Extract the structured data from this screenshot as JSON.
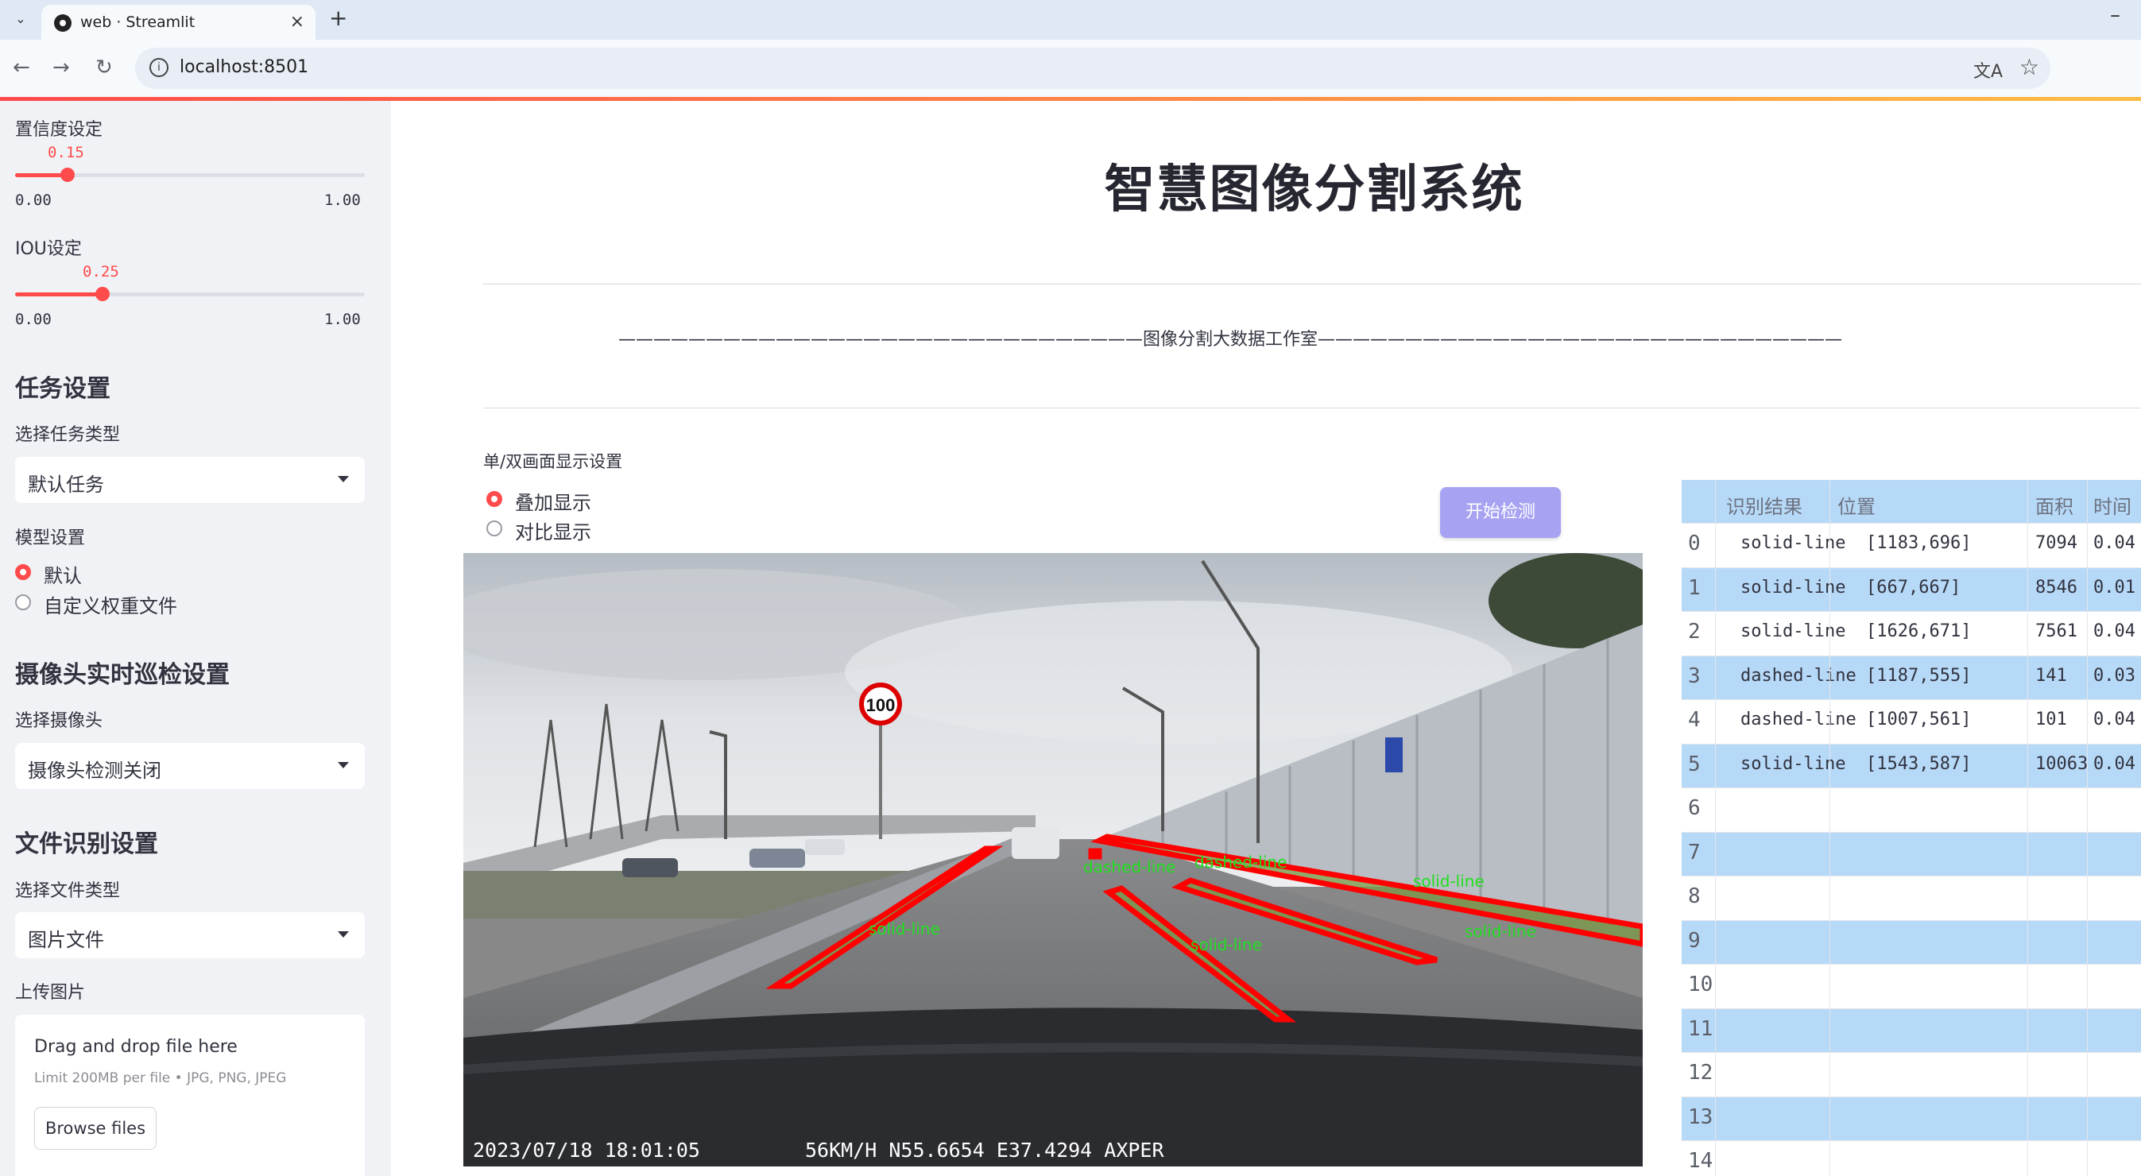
{
  "browser": {
    "tab_title": "web · Streamlit",
    "url": "localhost:8501",
    "close_symbol": "×",
    "new_tab_symbol": "+",
    "minimize_symbol": "–"
  },
  "sidebar": {
    "confidence": {
      "label": "置信度设定",
      "value": "0.15",
      "min": "0.00",
      "max": "1.00",
      "fraction": 0.15
    },
    "iou": {
      "label": "IOU设定",
      "value": "0.25",
      "min": "0.00",
      "max": "1.00",
      "fraction": 0.25
    },
    "task_heading": "任务设置",
    "task_type_label": "选择任务类型",
    "task_type_value": "默认任务",
    "model_label": "模型设置",
    "model_options": [
      "默认",
      "自定义权重文件"
    ],
    "camera_heading": "摄像头实时巡检设置",
    "camera_label": "选择摄像头",
    "camera_value": "摄像头检测关闭",
    "file_heading": "文件识别设置",
    "file_type_label": "选择文件类型",
    "file_type_value": "图片文件",
    "upload_label": "上传图片",
    "upload_title": "Drag and drop file here",
    "upload_sub": "Limit 200MB per file • JPG, PNG, JPEG",
    "upload_button": "Browse files"
  },
  "main": {
    "title": "智慧图像分割系统",
    "studio_line": "——————————————————————————————图像分割大数据工作室——————————————————————————————",
    "display_label": "单/双画面显示设置",
    "display_options": [
      "叠加显示",
      "对比显示"
    ],
    "start_button": "开始检测"
  },
  "image": {
    "timestamp": "2023/07/18 18:01:05",
    "telemetry": "56KM/H N55.6654 E37.4294 AXPER",
    "speed_sign": "100",
    "detections": [
      "solid-line",
      "solid-line",
      "solid-line",
      "solid-line",
      "dashed-line",
      "dashed-line"
    ]
  },
  "table": {
    "headers": [
      "识别结果",
      "位置",
      "面积",
      "时间"
    ],
    "rows": [
      {
        "idx": "0",
        "result": "solid-line",
        "pos": "[1183,696]",
        "area": "7094",
        "time": "0.04"
      },
      {
        "idx": "1",
        "result": "solid-line",
        "pos": "[667,667]",
        "area": "8546",
        "time": "0.01"
      },
      {
        "idx": "2",
        "result": "solid-line",
        "pos": "[1626,671]",
        "area": "7561",
        "time": "0.04"
      },
      {
        "idx": "3",
        "result": "dashed-line",
        "pos": "[1187,555]",
        "area": "141",
        "time": "0.03"
      },
      {
        "idx": "4",
        "result": "dashed-line",
        "pos": "[1007,561]",
        "area": "101",
        "time": "0.04"
      },
      {
        "idx": "5",
        "result": "solid-line",
        "pos": "[1543,587]",
        "area": "10063",
        "time": "0.04"
      },
      {
        "idx": "6"
      },
      {
        "idx": "7"
      },
      {
        "idx": "8"
      },
      {
        "idx": "9"
      },
      {
        "idx": "10"
      },
      {
        "idx": "11"
      },
      {
        "idx": "12"
      },
      {
        "idx": "13"
      },
      {
        "idx": "14"
      }
    ]
  }
}
